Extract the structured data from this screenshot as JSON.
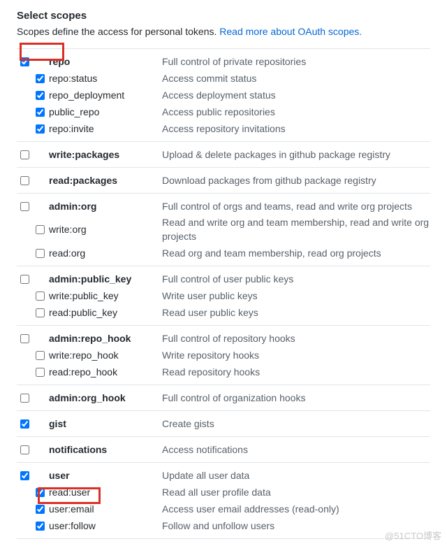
{
  "heading": "Select scopes",
  "subtext_prefix": "Scopes define the access for personal tokens. ",
  "subtext_link": "Read more about OAuth scopes.",
  "watermark": "@51CTO博客",
  "groups": [
    {
      "parent": {
        "name": "repo",
        "desc": "Full control of private repositories",
        "checked": true
      },
      "children": [
        {
          "name": "repo:status",
          "desc": "Access commit status",
          "checked": true
        },
        {
          "name": "repo_deployment",
          "desc": "Access deployment status",
          "checked": true
        },
        {
          "name": "public_repo",
          "desc": "Access public repositories",
          "checked": true
        },
        {
          "name": "repo:invite",
          "desc": "Access repository invitations",
          "checked": true
        }
      ]
    },
    {
      "parent": {
        "name": "write:packages",
        "desc": "Upload & delete packages in github package registry",
        "checked": false
      },
      "children": []
    },
    {
      "parent": {
        "name": "read:packages",
        "desc": "Download packages from github package registry",
        "checked": false
      },
      "children": []
    },
    {
      "parent": {
        "name": "admin:org",
        "desc": "Full control of orgs and teams, read and write org projects",
        "checked": false
      },
      "children": [
        {
          "name": "write:org",
          "desc": "Read and write org and team membership, read and write org projects",
          "checked": false
        },
        {
          "name": "read:org",
          "desc": "Read org and team membership, read org projects",
          "checked": false
        }
      ]
    },
    {
      "parent": {
        "name": "admin:public_key",
        "desc": "Full control of user public keys",
        "checked": false
      },
      "children": [
        {
          "name": "write:public_key",
          "desc": "Write user public keys",
          "checked": false
        },
        {
          "name": "read:public_key",
          "desc": "Read user public keys",
          "checked": false
        }
      ]
    },
    {
      "parent": {
        "name": "admin:repo_hook",
        "desc": "Full control of repository hooks",
        "checked": false
      },
      "children": [
        {
          "name": "write:repo_hook",
          "desc": "Write repository hooks",
          "checked": false
        },
        {
          "name": "read:repo_hook",
          "desc": "Read repository hooks",
          "checked": false
        }
      ]
    },
    {
      "parent": {
        "name": "admin:org_hook",
        "desc": "Full control of organization hooks",
        "checked": false
      },
      "children": []
    },
    {
      "parent": {
        "name": "gist",
        "desc": "Create gists",
        "checked": true
      },
      "children": []
    },
    {
      "parent": {
        "name": "notifications",
        "desc": "Access notifications",
        "checked": false
      },
      "children": []
    },
    {
      "parent": {
        "name": "user",
        "desc": "Update all user data",
        "checked": true
      },
      "children": [
        {
          "name": "read:user",
          "desc": "Read all user profile data",
          "checked": true
        },
        {
          "name": "user:email",
          "desc": "Access user email addresses (read-only)",
          "checked": true
        },
        {
          "name": "user:follow",
          "desc": "Follow and unfollow users",
          "checked": true
        }
      ]
    }
  ]
}
